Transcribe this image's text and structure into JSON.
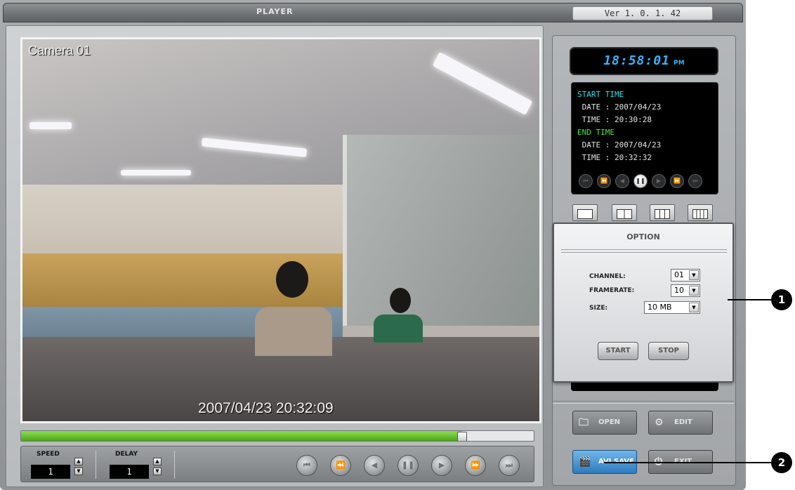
{
  "window": {
    "title": "PLAYER",
    "version": "Ver 1. 0. 1. 42"
  },
  "video": {
    "camera_label": "Camera 01",
    "timestamp": "2007/04/23 20:32:09"
  },
  "playback": {
    "progress_fraction": 0.86
  },
  "controls": {
    "speed_label": "SPEED",
    "speed_value": "1",
    "delay_label": "DELAY",
    "delay_value": "1",
    "transport": [
      "skip-back-icon",
      "rewind-icon",
      "step-back-icon",
      "pause-icon",
      "play-icon",
      "fast-forward-icon",
      "skip-forward-icon"
    ]
  },
  "clock": {
    "time": "18:58:01",
    "ampm": "PM"
  },
  "info": {
    "start_header": "START TIME",
    "start_date": " DATE : 2007/04/23",
    "start_time": " TIME : 20:30:28",
    "end_header": "END TIME",
    "end_date": " DATE : 2007/04/23",
    "end_time": " TIME : 20:32:32"
  },
  "option": {
    "title": "OPTION",
    "channel_label": "CHANNEL:",
    "channel_value": "01",
    "framerate_label": "FRAMERATE:",
    "framerate_value": "10",
    "size_label": "SIZE:",
    "size_value": "10 MB",
    "start_label": "START",
    "stop_label": "STOP"
  },
  "menu": {
    "open_label": "OPEN",
    "edit_label": "EDIT",
    "avisave_label": "AVI SAVE",
    "exit_label": "EXIT"
  },
  "callouts": {
    "one": "1",
    "two": "2"
  },
  "colors": {
    "progress": "#5cc22a",
    "clock": "#35b6ff",
    "start_header": "#37e0e8",
    "end_header": "#47ea3e",
    "active_button": "#3b8dcf"
  }
}
